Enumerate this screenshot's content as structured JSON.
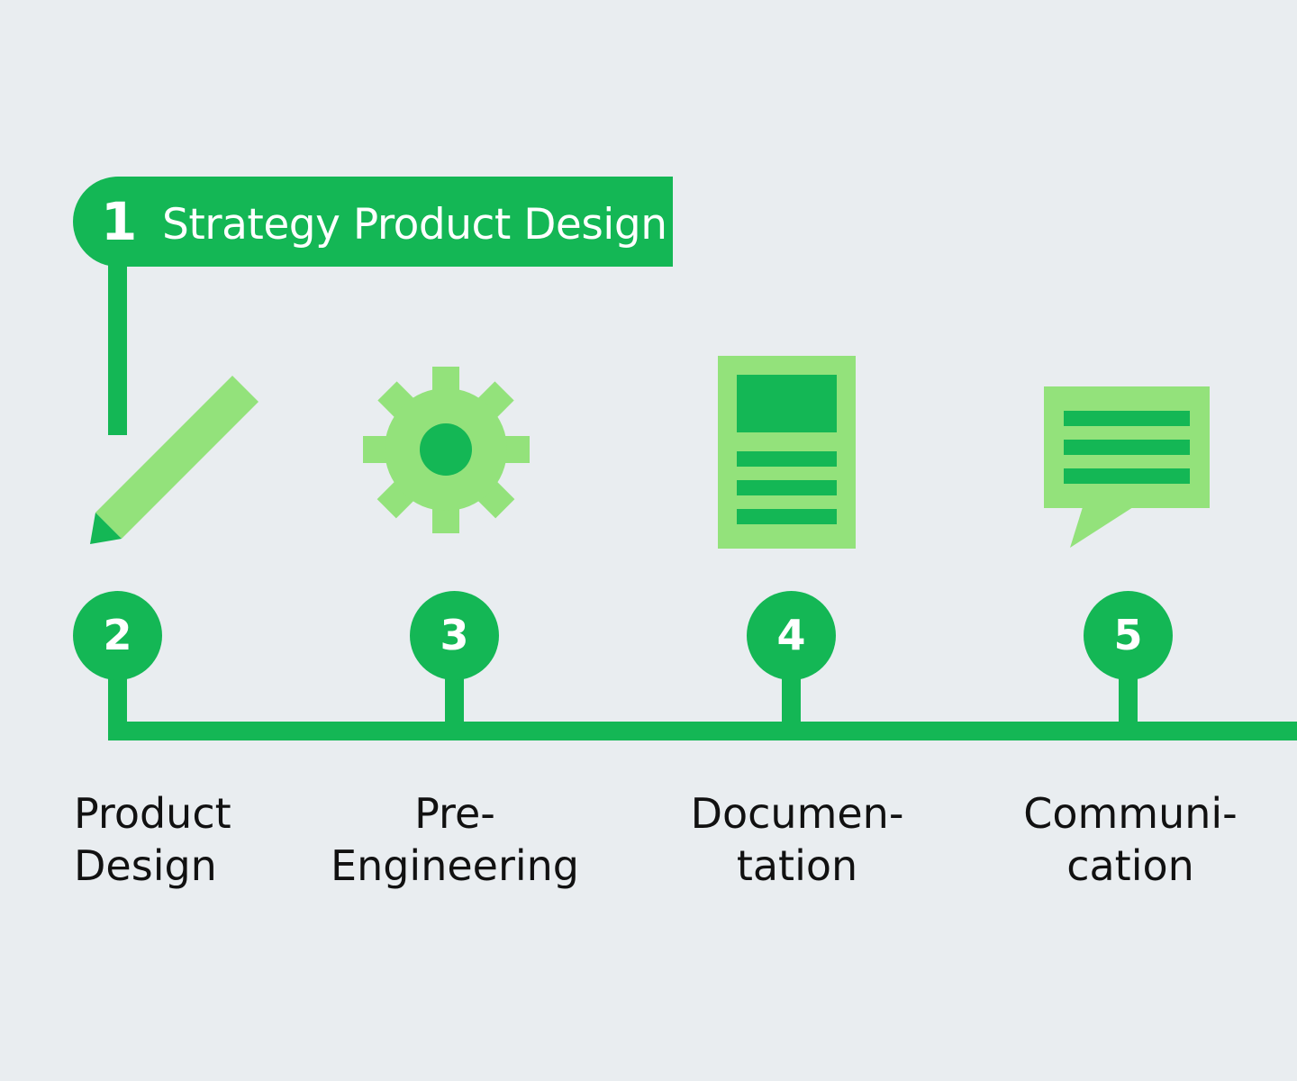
{
  "colors": {
    "background": "#e9edf0",
    "primary_green": "#14b755",
    "light_green": "#93e27b",
    "text": "#111111"
  },
  "banner": {
    "number": "1",
    "title": "Strategy Product Design"
  },
  "steps": [
    {
      "number": "2",
      "label_line1": "Product",
      "label_line2": "Design",
      "icon": "pencil-icon"
    },
    {
      "number": "3",
      "label_line1": "Pre-",
      "label_line2": "Engineering",
      "icon": "gear-icon"
    },
    {
      "number": "4",
      "label_line1": "Documen-",
      "label_line2": "tation",
      "icon": "document-icon"
    },
    {
      "number": "5",
      "label_line1": "Communi-",
      "label_line2": "cation",
      "icon": "speech-bubble-icon"
    }
  ]
}
